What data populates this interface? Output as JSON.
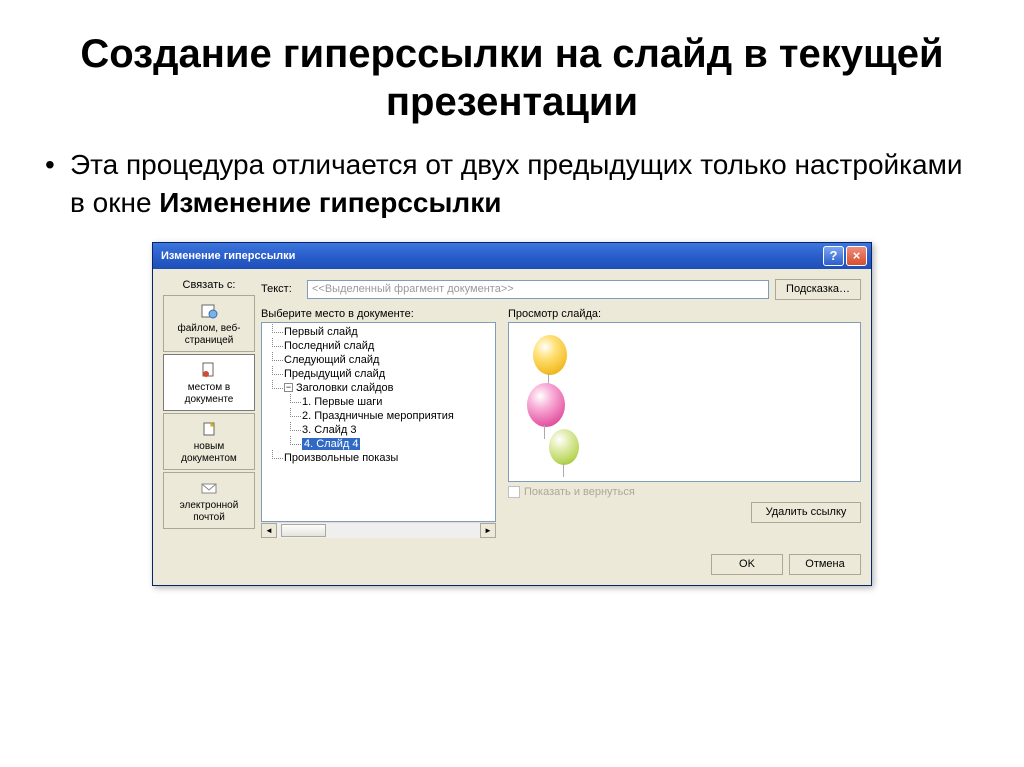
{
  "slide": {
    "title": "Создание гиперссылки на слайд в текущей презентации",
    "bullet_text": "Эта процедура отличается от двух предыдущих только настройками в окне ",
    "bullet_bold": "Изменение гиперссылки"
  },
  "dialog": {
    "title": "Изменение гиперссылки",
    "help": "?",
    "close": "×",
    "link_with_label": "Связать с:",
    "tabs": {
      "file": "файлом, веб-страницей",
      "place": "местом в документе",
      "newdoc": "новым документом",
      "email": "электронной почтой"
    },
    "text_label": "Текст:",
    "text_placeholder": "<<Выделенный фрагмент документа>>",
    "tip_button": "Подсказка…",
    "tree_label": "Выберите место в документе:",
    "preview_label": "Просмотр слайда:",
    "tree": {
      "first": "Первый слайд",
      "last": "Последний слайд",
      "next": "Следующий слайд",
      "prev": "Предыдущий слайд",
      "titles_group": "Заголовки слайдов",
      "s1": "1. Первые шаги",
      "s2": "2. Праздничные мероприятия",
      "s3": "3. Слайд 3",
      "s4": "4. Слайд 4",
      "custom": "Произвольные показы"
    },
    "checkbox_label": "Показать и вернуться",
    "delete_button": "Удалить ссылку",
    "ok_button": "OK",
    "cancel_button": "Отмена"
  }
}
